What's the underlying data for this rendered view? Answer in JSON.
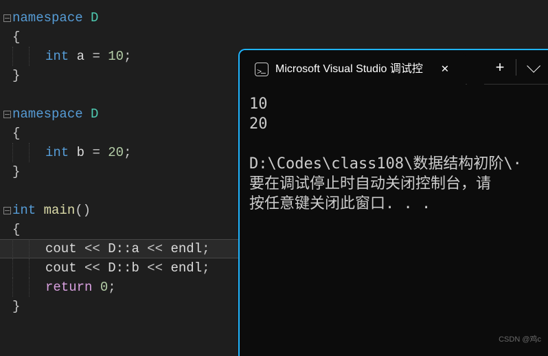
{
  "code": {
    "ns1_decl": "namespace",
    "ns1_name": "D",
    "brace_open": "{",
    "brace_close": "}",
    "int_kw": "int",
    "var_a": "a",
    "assign": "=",
    "val_a": "10",
    "semi": ";",
    "ns2_decl": "namespace",
    "ns2_name": "D",
    "var_b": "b",
    "val_b": "20",
    "main_kw": "int",
    "main_fn": "main",
    "parens": "()",
    "cout": "cout",
    "ins": "<<",
    "scope": "D::",
    "ref_a": "a",
    "ref_b": "b",
    "endl": "endl",
    "ret": "return",
    "ret_val": "0"
  },
  "console": {
    "tab_title": "Microsoft Visual Studio 调试控",
    "close_glyph": "✕",
    "plus_glyph": "+",
    "out_line1": "10",
    "out_line2": "20",
    "blank": "",
    "path_line": "D:\\Codes\\class108\\数据结构初阶\\·",
    "msg_line1": "要在调试停止时自动关闭控制台，请",
    "msg_line2": "按任意键关闭此窗口. . ."
  },
  "watermark": "CSDN @鸡c"
}
